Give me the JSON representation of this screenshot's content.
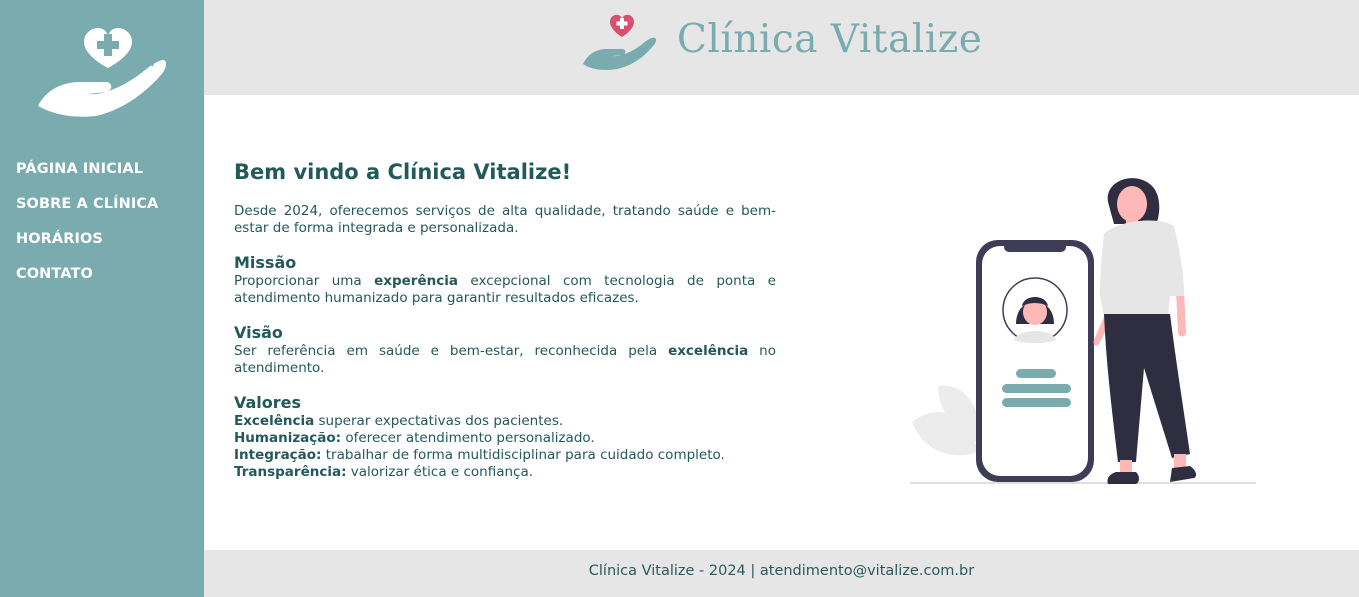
{
  "brand": {
    "name": "Clínica Vitalize",
    "accent_color": "#7aabae",
    "heart_color": "#d9506e",
    "logo_icon": "hand-heart-cross-icon"
  },
  "nav": {
    "items": [
      {
        "label": "PÁGINA INICIAL"
      },
      {
        "label": "SOBRE A CLÍNICA"
      },
      {
        "label": "HORÁRIOS"
      },
      {
        "label": "CONTATO"
      }
    ]
  },
  "main": {
    "title": "Bem vindo a Clínica Vitalize!",
    "intro": "Desde 2024, oferecemos serviços de alta qualidade, tratando saúde e bem-estar de forma integrada e personalizada.",
    "mission": {
      "heading": "Missão",
      "before": "Proporcionar uma ",
      "strong": "experência",
      "after": " excepcional com tecnologia de ponta e atendimento humanizado para garantir resultados eficazes."
    },
    "vision": {
      "heading": "Visão",
      "before": "Ser referência em saúde e bem-estar, reconhecida pela ",
      "strong": "excelência",
      "after": " no atendimento."
    },
    "values": {
      "heading": "Valores",
      "items": [
        {
          "strong": "Excelência",
          "text": " superar expectativas dos pacientes."
        },
        {
          "strong": "Humanização:",
          "text": " oferecer atendimento personalizado."
        },
        {
          "strong": "Integração:",
          "text": " trabalhar de forma multidisciplinar para cuidado completo."
        },
        {
          "strong": "Transparência:",
          "text": " valorizar ética e confiança."
        }
      ]
    }
  },
  "footer": {
    "text": "Clínica Vitalize - 2024 | atendimento@vitalize.com.br"
  }
}
